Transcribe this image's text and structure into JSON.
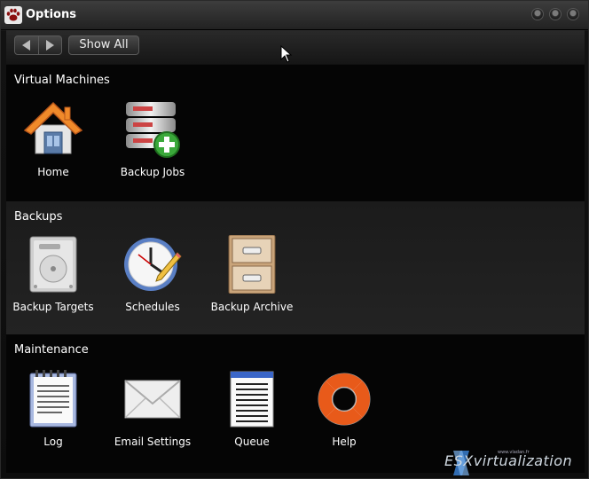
{
  "window": {
    "title": "Options"
  },
  "toolbar": {
    "back_label": "Back",
    "forward_label": "Forward",
    "show_all_label": "Show All"
  },
  "sections": [
    {
      "title": "Virtual Machines",
      "items": [
        {
          "label": "Home",
          "icon": "home-icon"
        },
        {
          "label": "Backup Jobs",
          "icon": "backup-jobs-icon"
        }
      ]
    },
    {
      "title": "Backups",
      "items": [
        {
          "label": "Backup Targets",
          "icon": "hard-drive-icon"
        },
        {
          "label": "Schedules",
          "icon": "clock-icon"
        },
        {
          "label": "Backup Archive",
          "icon": "filing-cabinet-icon"
        }
      ]
    },
    {
      "title": "Maintenance",
      "items": [
        {
          "label": "Log",
          "icon": "notepad-icon"
        },
        {
          "label": "Email Settings",
          "icon": "envelope-icon"
        },
        {
          "label": "Queue",
          "icon": "queue-list-icon"
        },
        {
          "label": "Help",
          "icon": "lifebuoy-icon"
        }
      ]
    }
  ],
  "watermark": {
    "text": "ESXvirtualization",
    "url": "www.vladan.fr"
  }
}
